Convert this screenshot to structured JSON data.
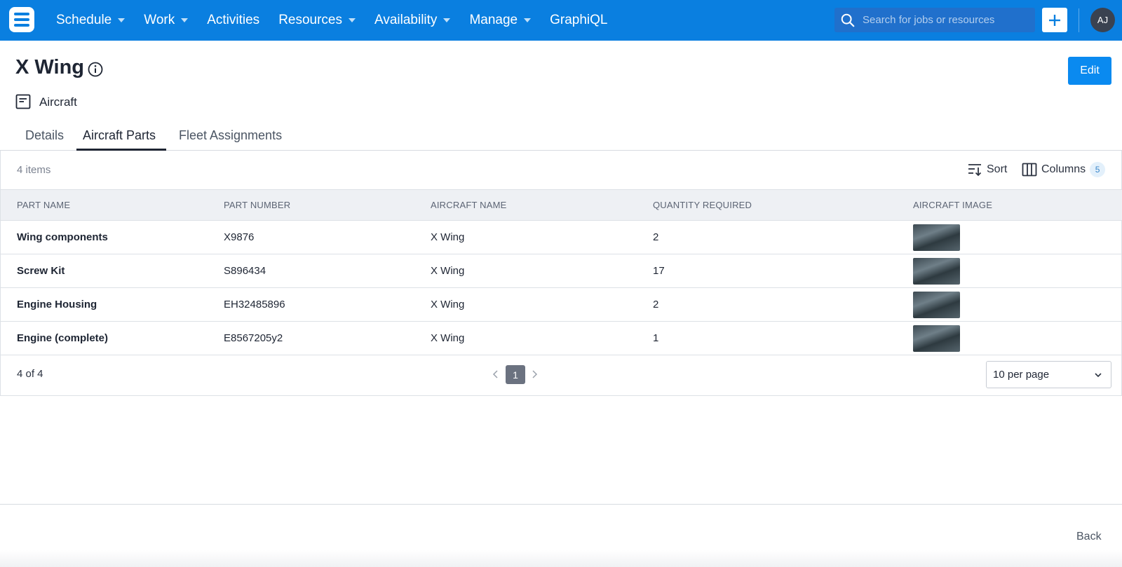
{
  "nav": {
    "items": [
      {
        "label": "Schedule",
        "has_caret": true
      },
      {
        "label": "Work",
        "has_caret": true
      },
      {
        "label": "Activities",
        "has_caret": false
      },
      {
        "label": "Resources",
        "has_caret": true
      },
      {
        "label": "Availability",
        "has_caret": true
      },
      {
        "label": "Manage",
        "has_caret": true
      },
      {
        "label": "GraphiQL",
        "has_caret": false
      }
    ],
    "search_placeholder": "Search for jobs or resources",
    "avatar_initials": "AJ",
    "brand_color": "#0a7fe0"
  },
  "header": {
    "title": "X Wing",
    "type_label": "Aircraft",
    "edit_label": "Edit"
  },
  "tabs": [
    {
      "label": "Details",
      "active": false
    },
    {
      "label": "Aircraft Parts",
      "active": true
    },
    {
      "label": "Fleet Assignments",
      "active": false
    }
  ],
  "table": {
    "item_count": "4 items",
    "sort_label": "Sort",
    "columns_label": "Columns",
    "columns_count": "5",
    "headers": [
      "Part Name",
      "Part Number",
      "Aircraft Name",
      "Quantity Required",
      "Aircraft Image"
    ],
    "rows": [
      {
        "part_name": "Wing components",
        "part_number": "X9876",
        "aircraft_name": "X Wing",
        "quantity": "2"
      },
      {
        "part_name": "Screw Kit",
        "part_number": "S896434",
        "aircraft_name": "X Wing",
        "quantity": "17"
      },
      {
        "part_name": "Engine Housing",
        "part_number": "EH32485896",
        "aircraft_name": "X Wing",
        "quantity": "2"
      },
      {
        "part_name": "Engine (complete)",
        "part_number": "E8567205y2",
        "aircraft_name": "X Wing",
        "quantity": "1"
      }
    ]
  },
  "pager": {
    "range": "4 of 4",
    "current_page": "1",
    "per_page": "10 per page"
  },
  "footer": {
    "back_label": "Back"
  }
}
